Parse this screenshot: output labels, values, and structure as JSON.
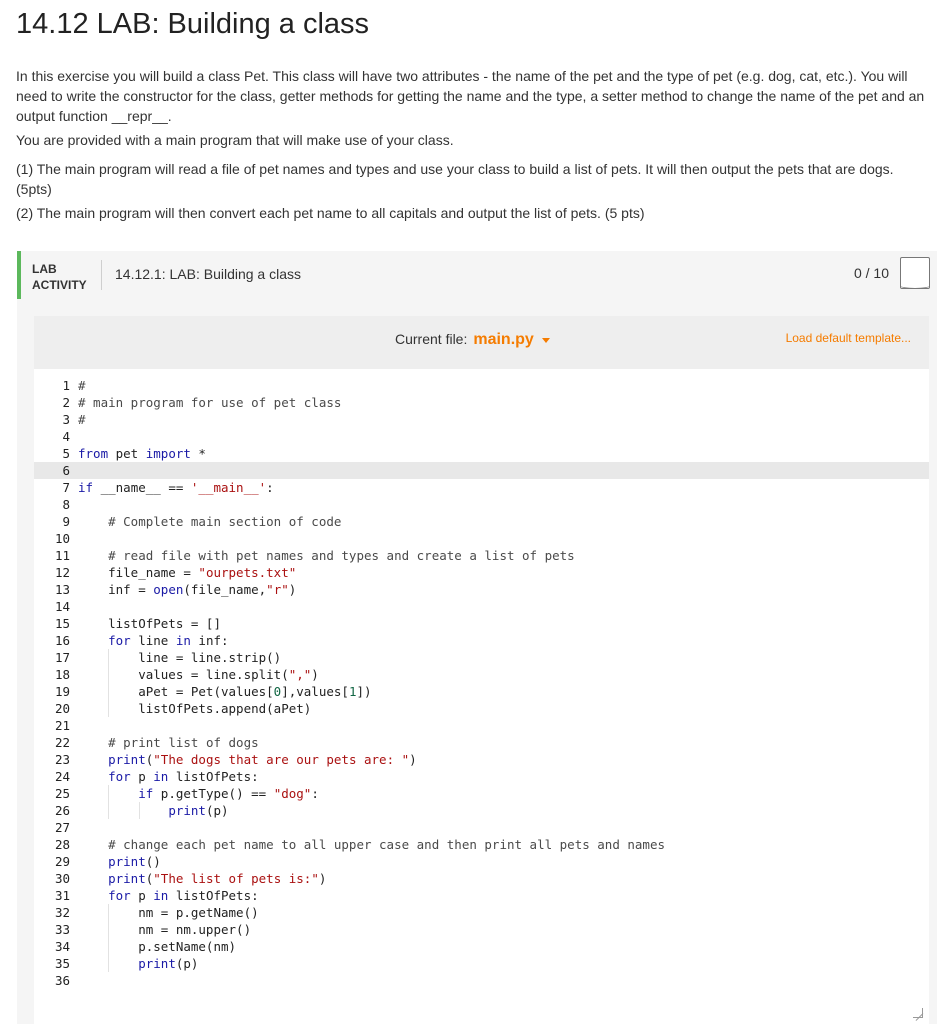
{
  "page": {
    "title": "14.12 LAB: Building a class",
    "paragraphs": [
      "In this exercise you will build a class Pet. This class will have two attributes - the name of the pet and the type of pet (e.g. dog, cat, etc.). You will need to write the constructor for the class, getter methods for getting the name and the type, a setter method to change the name of the pet and an output function __repr__.",
      "You are provided with a main program that will make use of your class.",
      "(1) The main program will read a file of pet names and types and use your class to build a list of pets. It will then output the pets that are dogs. (5pts)",
      "(2) The main program will then convert each pet name to all capitals and output the list of pets. (5 pts)"
    ]
  },
  "lab": {
    "tag_line1": "LAB",
    "tag_line2": "ACTIVITY",
    "name": "14.12.1: LAB: Building a class",
    "score": "0 / 10",
    "accent_color": "#5cb85c"
  },
  "editor": {
    "current_file_label": "Current file:",
    "current_file": "main.py",
    "load_template": "Load default template...",
    "accent_color": "#f57c00",
    "line_numbers": [
      "1",
      "2",
      "3",
      "4",
      "5",
      "6",
      "7",
      "8",
      "9",
      "10",
      "11",
      "12",
      "13",
      "14",
      "15",
      "16",
      "17",
      "18",
      "19",
      "20",
      "21",
      "22",
      "23",
      "24",
      "25",
      "26",
      "27",
      "28",
      "29",
      "30",
      "31",
      "32",
      "33",
      "34",
      "35",
      "36"
    ],
    "code_lines": [
      "#",
      "# main program for use of pet class",
      "#",
      "",
      "from pet import *",
      "",
      "if __name__ == '__main__':",
      "",
      "    # Complete main section of code",
      "",
      "    # read file with pet names and types and create a list of pets",
      "    file_name = \"ourpets.txt\"",
      "    inf = open(file_name,\"r\")",
      "",
      "    listOfPets = []",
      "    for line in inf:",
      "        line = line.strip()",
      "        values = line.split(\",\")",
      "        aPet = Pet(values[0],values[1])",
      "        listOfPets.append(aPet)",
      "",
      "    # print list of dogs",
      "    print(\"The dogs that are our pets are: \")",
      "    for p in listOfPets:",
      "        if p.getType() == \"dog\":",
      "            print(p)",
      "",
      "    # change each pet name to all upper case and then print all pets and names",
      "    print()",
      "    print(\"The list of pets is:\")",
      "    for p in listOfPets:",
      "        nm = p.getName()",
      "        nm = nm.upper()",
      "        p.setName(nm)",
      "        print(p)",
      ""
    ]
  }
}
